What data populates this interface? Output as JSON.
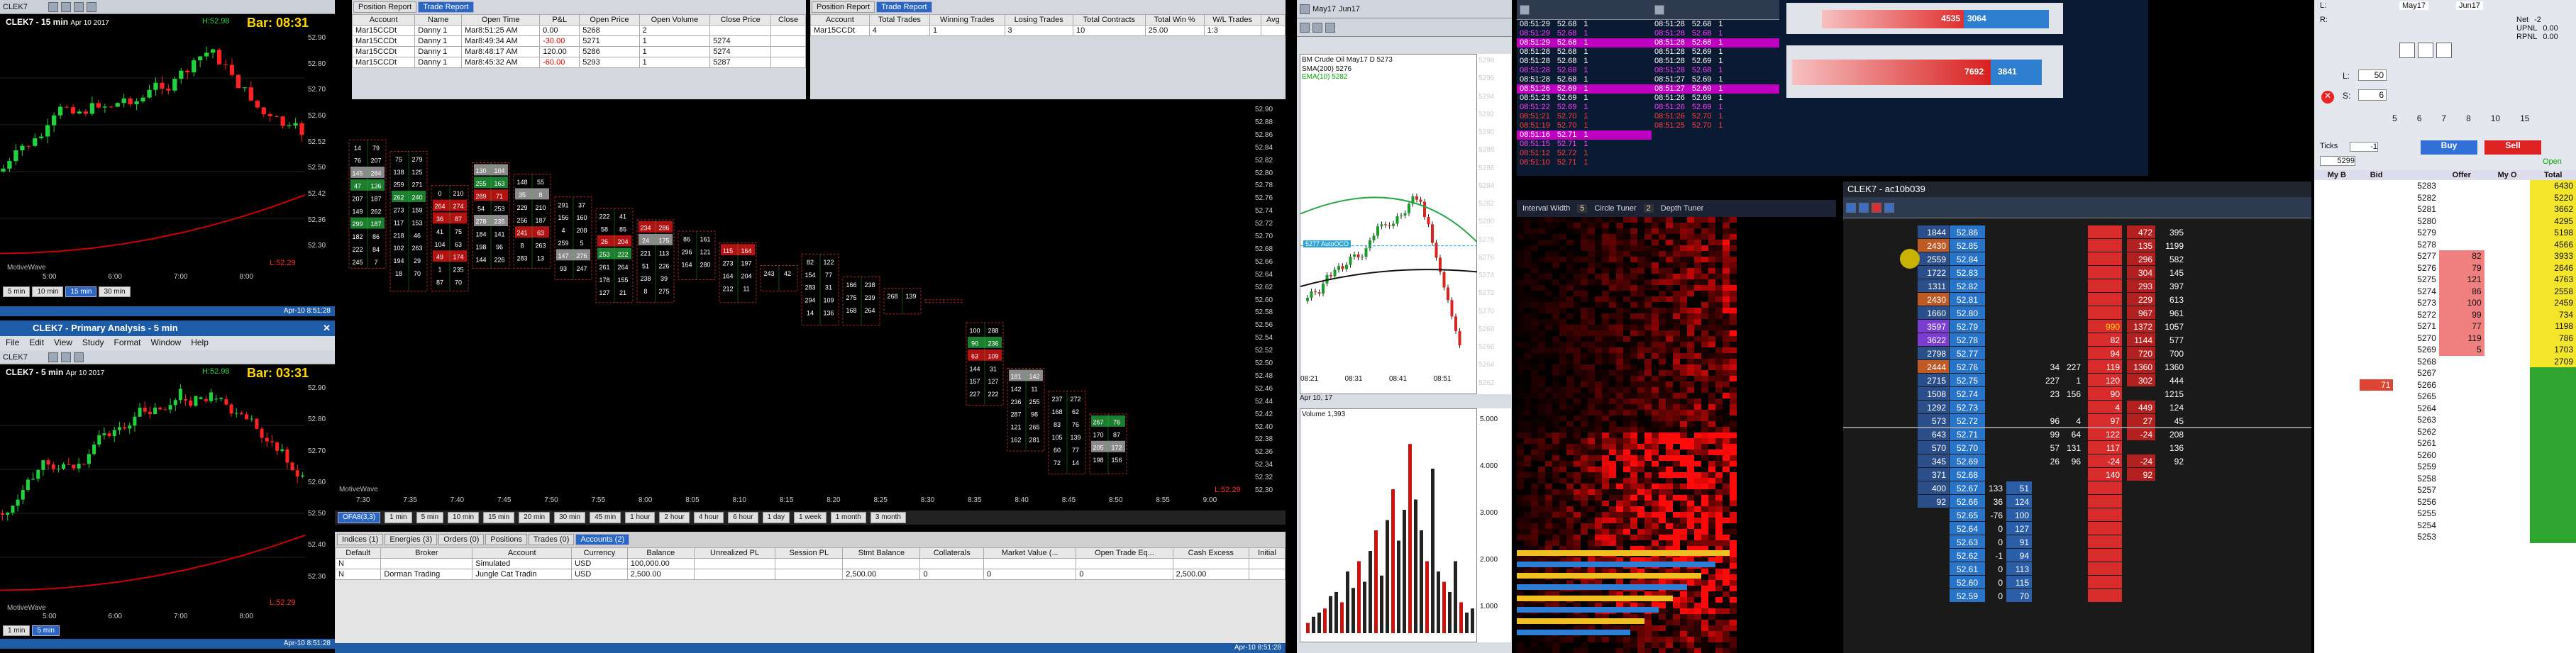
{
  "chart_top": {
    "symbol": "CLEK7 - 15 min",
    "date": "Apr 10 2017",
    "hi": "H:52.98",
    "bar": "Bar: 08:31",
    "lo": "L:52.29",
    "footer": "MotiveWave",
    "prices": [
      "52.90",
      "52.80",
      "52.70",
      "52.60",
      "52.52",
      "52.50",
      "52.42",
      "52.36",
      "52.30"
    ],
    "times": [
      "5:00",
      "6:00",
      "7:00",
      "8:00"
    ],
    "periods": [
      "5 min",
      "10 min",
      "15 min",
      "30 min"
    ],
    "timestamp": "Apr-10 8:51:28"
  },
  "chart_primary": {
    "title": "CLEK7 - Primary Analysis - 5 min",
    "menu": [
      "File",
      "Edit",
      "View",
      "Study",
      "Format",
      "Window",
      "Help"
    ],
    "symbol": "CLEK7",
    "sub": "CLEK7 - 5 min",
    "date": "Apr 10 2017",
    "hi": "H:52.98",
    "bar": "Bar: 03:31",
    "lo": "L:52.29",
    "footer": "MotiveWave",
    "prices": [
      "52.90",
      "52.80",
      "52.70",
      "52.60",
      "52.50",
      "52.40",
      "52.30"
    ],
    "times": [
      "5:00",
      "6:00",
      "7:00",
      "8:00"
    ],
    "periods": [
      "1 min",
      "5 min"
    ],
    "timestamp": "Apr-10 8:51:28"
  },
  "position_report": {
    "tabs": [
      "Position Report",
      "Trade Report"
    ],
    "headers": [
      "Account",
      "Name",
      "Open Time",
      "P&L",
      "Open Price",
      "Open Volume",
      "Close Price",
      "Close"
    ],
    "rows": [
      [
        "Mar15CCDt",
        "Danny 1",
        "Mar8:51:25 AM",
        "0.00",
        "5268",
        "2",
        "",
        ""
      ],
      [
        "Mar15CCDt",
        "Danny 1",
        "Mar8:49:34 AM",
        "-30.00",
        "5271",
        "1",
        "5274",
        ""
      ],
      [
        "Mar15CCDt",
        "Danny 1",
        "Mar8:48:17 AM",
        "120.00",
        "5286",
        "1",
        "5274",
        ""
      ],
      [
        "Mar15CCDt",
        "Danny 1",
        "Mar8:45:32 AM",
        "-60.00",
        "5293",
        "1",
        "5287",
        ""
      ]
    ]
  },
  "trade_report": {
    "tabs": [
      "Position Report",
      "Trade Report"
    ],
    "headers": [
      "Account",
      "Total Trades",
      "Winning Trades",
      "Losing Trades",
      "Total Contracts",
      "Total Win %",
      "W/L Trades",
      "Avg"
    ],
    "rows": [
      [
        "Mar15CCDt",
        "4",
        "1",
        "3",
        "10",
        "25.00",
        "1:3",
        ""
      ]
    ]
  },
  "footprint": {
    "prices": [
      "52.90",
      "52.88",
      "52.86",
      "52.84",
      "52.82",
      "52.80",
      "52.78",
      "52.76",
      "52.74",
      "52.72",
      "52.70",
      "52.68",
      "52.66",
      "52.64",
      "52.62",
      "52.60",
      "52.58",
      "52.56",
      "52.54",
      "52.52",
      "52.50",
      "52.48",
      "52.46",
      "52.44",
      "52.42",
      "52.40",
      "52.38",
      "52.36",
      "52.34",
      "52.32",
      "52.30"
    ],
    "times": [
      "7:30",
      "7:35",
      "7:40",
      "7:45",
      "7:50",
      "7:55",
      "8:00",
      "8:05",
      "8:10",
      "8:15",
      "8:20",
      "8:25",
      "8:30",
      "8:35",
      "8:40",
      "8:45",
      "8:50",
      "8:55",
      "9:00"
    ],
    "periods": [
      "OFA8(3,3)",
      "1 min",
      "5 min",
      "10 min",
      "15 min",
      "20 min",
      "30 min",
      "45 min",
      "1 hour",
      "2 hour",
      "4 hour",
      "6 hour",
      "1 day",
      "1 week",
      "1 month",
      "3 month"
    ],
    "price_tags": [
      "52.42",
      "52.38",
      "52.30"
    ],
    "footer": "MotiveWave",
    "low_tag": "L:52.29"
  },
  "accounts": {
    "tabs": [
      "Indices (1)",
      "Energies (3)",
      "Orders (0)",
      "Positions",
      "Trades (0)",
      "Accounts (2)"
    ],
    "headers": [
      "Default",
      "Broker",
      "Account",
      "Currency",
      "Balance",
      "Unrealized PL",
      "Session PL",
      "Stmt Balance",
      "Collaterals",
      "Market Value (...",
      "Open Trade Eq...",
      "Cash Excess",
      "Initial"
    ],
    "rows": [
      [
        "N",
        "",
        "Simulated",
        "USD",
        "100,000.00",
        "",
        "",
        "",
        "",
        "",
        "",
        "",
        ""
      ],
      [
        "N",
        "Dorman Trading",
        "Jungle Cat Tradin",
        "USD",
        "2,500.00",
        "",
        "",
        "2,500.00",
        "0",
        "0",
        "0",
        "2,500.00",
        ""
      ]
    ],
    "timestamp": "Apr-10 8:51:28"
  },
  "cl_chart": {
    "header": "BM Crude Oil May17 D 5273",
    "study1": "SMA(200) 5276",
    "study2": "EMA(10) 5282",
    "price_ticks": [
      "5298",
      "5296",
      "5294",
      "5292",
      "5290",
      "5288",
      "5286",
      "5284",
      "5282",
      "5280",
      "5278",
      "5276",
      "5274",
      "5272",
      "5270",
      "5268",
      "5266",
      "5264",
      "5262"
    ],
    "last_price": "5268",
    "time_ticks": [
      "08:21",
      "08:31",
      "08:41",
      "08:51"
    ],
    "date": "Apr 10, 17",
    "order_label": "5277 AutoOCO",
    "volume_label": "Volume 1,393",
    "volume_ticks": [
      "5.000",
      "4.000",
      "3.000",
      "2.000",
      "1.000"
    ],
    "volume_bars": [
      0.05,
      0.08,
      0.1,
      0.12,
      0.18,
      0.2,
      0.15,
      0.3,
      0.22,
      0.35,
      0.25,
      0.4,
      0.5,
      0.28,
      0.55,
      0.7,
      0.45,
      0.6,
      0.92,
      0.65,
      0.5,
      0.35,
      0.8,
      0.3,
      0.25,
      0.2,
      0.35,
      0.15,
      0.1,
      0.12
    ],
    "months": [
      "May17",
      "Jun17"
    ]
  },
  "time_sales_1": {
    "rows": [
      [
        "08:51:29",
        "52.68",
        "1"
      ],
      [
        "08:51:29",
        "52.68",
        "1"
      ],
      [
        "08:51:29",
        "52.68",
        "1"
      ],
      [
        "08:51:28",
        "52.68",
        "1"
      ],
      [
        "08:51:28",
        "52.68",
        "1"
      ],
      [
        "08:51:28",
        "52.68",
        "1"
      ],
      [
        "08:51:28",
        "52.68",
        "1"
      ],
      [
        "08:51:26",
        "52.69",
        "1"
      ],
      [
        "08:51:23",
        "52.69",
        "1"
      ],
      [
        "08:51:22",
        "52.69",
        "1"
      ],
      [
        "08:51:21",
        "52.70",
        "1"
      ],
      [
        "08:51:19",
        "52.70",
        "1"
      ],
      [
        "08:51:16",
        "52.71",
        "1"
      ],
      [
        "08:51:15",
        "52.71",
        "1"
      ],
      [
        "08:51:12",
        "52.72",
        "1"
      ],
      [
        "08:51:10",
        "52.71",
        "1"
      ]
    ]
  },
  "time_sales_2": {
    "rows": [
      [
        "08:51:28",
        "52.68",
        "1"
      ],
      [
        "08:51:28",
        "52.68",
        "1"
      ],
      [
        "08:51:28",
        "52.68",
        "1"
      ],
      [
        "08:51:28",
        "52.69",
        "1"
      ],
      [
        "08:51:28",
        "52.69",
        "1"
      ],
      [
        "08:51:28",
        "52.68",
        "1"
      ],
      [
        "08:51:27",
        "52.69",
        "1"
      ],
      [
        "08:51:27",
        "52.69",
        "1"
      ],
      [
        "08:51:26",
        "52.69",
        "1"
      ],
      [
        "08:51:26",
        "52.69",
        "1"
      ],
      [
        "08:51:26",
        "52.70",
        "1"
      ],
      [
        "08:51:25",
        "52.70",
        "1"
      ]
    ]
  },
  "time_sales_3": {
    "rows": [
      [
        "08:51:26",
        "52.69",
        "1"
      ],
      [
        "08:51:26",
        "52.69",
        "1"
      ],
      [
        "08:51:26",
        "52.69",
        "1"
      ],
      [
        "08:51:26",
        "52.69",
        "1"
      ],
      [
        "08:51:26",
        "52.69",
        "1"
      ],
      [
        "08:51:25",
        "52.70",
        "1"
      ],
      [
        "08:51:25",
        "52.70",
        "1"
      ],
      [
        "08:51:24",
        "52.70",
        "1"
      ]
    ]
  },
  "imbalance": {
    "bar1_left": "4535",
    "bar1_right": "3064",
    "bar2_left": "7692",
    "bar2_right": "3841"
  },
  "heatmap": {
    "interval_label": "Interval Width",
    "interval_value": "5",
    "circle_label": "Circle Tuner",
    "circle_value": "2",
    "depth_label": "Depth Tuner"
  },
  "dom": {
    "title": "CLEK7 - ac10b039",
    "prices": [
      "52.86",
      "52.85",
      "52.84",
      "52.83",
      "52.82",
      "52.81",
      "52.80",
      "52.79",
      "52.78",
      "52.77",
      "52.76",
      "52.75",
      "52.74",
      "52.73",
      "52.72",
      "52.71",
      "52.70",
      "52.69",
      "52.68",
      "52.67",
      "52.66",
      "52.65",
      "52.64",
      "52.63",
      "52.62",
      "52.61",
      "52.60",
      "52.59"
    ],
    "left_vol": [
      "1844",
      "2430",
      "2559",
      "1722",
      "1311",
      "2430",
      "1660",
      "3597",
      "3622",
      "2798",
      "2444",
      "2715",
      "1508",
      "1292",
      "573",
      "643",
      "570",
      "345",
      "371",
      "400",
      "92",
      "",
      "",
      "",
      "",
      "",
      "",
      ""
    ],
    "left_bid": [
      "",
      "",
      "",
      "",
      "",
      "",
      "",
      "",
      "",
      "",
      "",
      "",
      "",
      "",
      "",
      "",
      "",
      "",
      "",
      "133",
      "36",
      "-76",
      "0",
      "0",
      "-1",
      "0",
      "0",
      "0"
    ],
    "left_bidsz": [
      "",
      "",
      "",
      "",
      "",
      "",
      "",
      "",
      "",
      "",
      "",
      "",
      "",
      "",
      "",
      "",
      "",
      "",
      "",
      "51",
      "124",
      "100",
      "127",
      "91",
      "94",
      "113",
      "115",
      "70"
    ],
    "mid1": [
      "",
      "",
      "",
      "",
      "",
      "",
      "",
      "",
      "",
      "",
      "34",
      "227",
      "23",
      "",
      "96",
      "99",
      "57",
      "26",
      "",
      "",
      "",
      "",
      "",
      "",
      "",
      "",
      "",
      ""
    ],
    "mid2": [
      "",
      "",
      "",
      "",
      "",
      "",
      "",
      "",
      "",
      "",
      "227",
      "1",
      "156",
      "",
      "4",
      "64",
      "131",
      "96",
      "",
      "",
      "",
      "",
      "",
      "",
      "",
      "",
      "",
      ""
    ],
    "red_vals": [
      "",
      "",
      "",
      "",
      "",
      "",
      "",
      "990",
      "82",
      "94",
      "119",
      "120",
      "90",
      "4",
      "97",
      "122",
      "117",
      "-24",
      "140",
      "",
      "",
      "",
      "",
      "",
      "",
      "",
      "",
      ""
    ],
    "right1": [
      "472",
      "135",
      "296",
      "304",
      "293",
      "229",
      "967",
      "1372",
      "1144",
      "720",
      "1360",
      "302",
      "",
      "449",
      "27",
      "-24",
      "",
      "-24",
      "92",
      "",
      "",
      "",
      "",
      "",
      "",
      "",
      "",
      ""
    ],
    "right2": [
      "395",
      "1199",
      "582",
      "145",
      "397",
      "613",
      "961",
      "1057",
      "577",
      "700",
      "1360",
      "444",
      "1215",
      "124",
      "45",
      "208",
      "136",
      "92",
      "",
      "",
      "",
      "",
      "",
      "",
      "",
      "",
      "",
      ""
    ]
  },
  "ladder": {
    "months": [
      "May17",
      "Jun17"
    ],
    "labels_l": [
      "L:",
      "R:"
    ],
    "net_labels": [
      "Net",
      "UPNL",
      "RPNL"
    ],
    "net_vals": [
      "-2",
      "0.00",
      "0.00"
    ],
    "qty_label": "L:",
    "qty_value": "50",
    "s_label": "S:",
    "s_value": "6",
    "ticks_label": "Ticks",
    "ticks_value": "-1",
    "price_input": "5299",
    "buy": "Buy",
    "sell": "Sell",
    "open": "Open",
    "top_nums": [
      "5",
      "6",
      "7",
      "8",
      "10",
      "15"
    ],
    "headers": [
      "My B",
      "Bid",
      "",
      "Offer",
      "My O",
      "Total"
    ],
    "rows": [
      [
        "",
        "",
        "5283",
        "",
        "",
        "6430"
      ],
      [
        "",
        "",
        "5282",
        "",
        "",
        "5220"
      ],
      [
        "",
        "",
        "5281",
        "",
        "",
        "3662"
      ],
      [
        "",
        "",
        "5280",
        "",
        "",
        "4295"
      ],
      [
        "",
        "",
        "5279",
        "",
        "",
        "5198"
      ],
      [
        "",
        "",
        "5278",
        "",
        "",
        "4566"
      ],
      [
        "",
        "",
        "5277",
        "82",
        "",
        "3933"
      ],
      [
        "",
        "",
        "5276",
        "79",
        "",
        "2646"
      ],
      [
        "",
        "",
        "5275",
        "121",
        "",
        "4763"
      ],
      [
        "",
        "",
        "5274",
        "86",
        "",
        "2558"
      ],
      [
        "",
        "",
        "5273",
        "100",
        "",
        "2459"
      ],
      [
        "",
        "",
        "5272",
        "99",
        "",
        "734"
      ],
      [
        "",
        "",
        "5271",
        "77",
        "",
        "1198"
      ],
      [
        "",
        "",
        "5270",
        "119",
        "",
        "786"
      ],
      [
        "",
        "",
        "5269",
        "5",
        "",
        "1703"
      ],
      [
        "",
        "",
        "5268",
        "",
        "",
        "2709"
      ],
      [
        "",
        "",
        "5267",
        "",
        "",
        ""
      ],
      [
        "",
        "",
        "5266",
        "",
        "",
        ""
      ],
      [
        "",
        "",
        "5265",
        "",
        "",
        ""
      ],
      [
        "",
        "",
        "5264",
        "",
        "",
        ""
      ],
      [
        "",
        "",
        "5263",
        "",
        "",
        ""
      ],
      [
        "",
        "",
        "5262",
        "",
        "",
        ""
      ],
      [
        "",
        "",
        "5261",
        "",
        "",
        ""
      ],
      [
        "",
        "",
        "5260",
        "",
        "",
        ""
      ],
      [
        "",
        "",
        "5259",
        "",
        "",
        ""
      ],
      [
        "",
        "",
        "5258",
        "",
        "",
        ""
      ],
      [
        "",
        "",
        "5257",
        "",
        "",
        ""
      ],
      [
        "",
        "",
        "5256",
        "",
        "",
        ""
      ],
      [
        "",
        "",
        "5255",
        "",
        "",
        ""
      ],
      [
        "",
        "",
        "5254",
        "",
        "",
        ""
      ],
      [
        "",
        "",
        "5253",
        "",
        "",
        ""
      ]
    ],
    "left_bids": [
      "",
      "",
      "",
      "",
      "",
      "",
      "",
      "",
      "",
      "",
      "",
      "",
      "",
      "",
      "",
      "",
      "",
      "71",
      "",
      "",
      "",
      "",
      "",
      "",
      "",
      "",
      "",
      "",
      "",
      "",
      ""
    ]
  }
}
